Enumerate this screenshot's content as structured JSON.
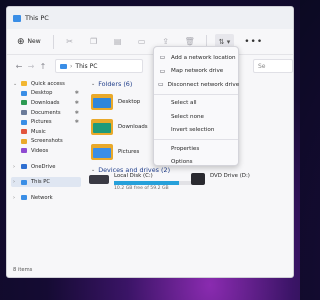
{
  "window": {
    "title": "This PC"
  },
  "toolbar": {
    "new_label": "New",
    "icons": [
      "scissors-icon",
      "copy-icon",
      "paste-icon",
      "rename-icon",
      "share-icon",
      "delete-icon"
    ],
    "sort_icon": "sort-icon",
    "more_label": "•••"
  },
  "address": {
    "back": "←",
    "forward": "→",
    "up": "↑",
    "path_label": "This PC",
    "search_placeholder": "Se"
  },
  "sidebar": {
    "items": [
      {
        "label": "Quick access",
        "color": "#f2b632",
        "pinned": false,
        "expand": true
      },
      {
        "label": "Desktop",
        "color": "#3a8ee6",
        "pinned": true
      },
      {
        "label": "Downloads",
        "color": "#2d9a52",
        "pinned": true
      },
      {
        "label": "Documents",
        "color": "#6b7b99",
        "pinned": true
      },
      {
        "label": "Pictures",
        "color": "#3a8ee6",
        "pinned": true
      },
      {
        "label": "Music",
        "color": "#e2553d",
        "pinned": false
      },
      {
        "label": "Screenshots",
        "color": "#e9a92a",
        "pinned": false
      },
      {
        "label": "Videos",
        "color": "#8f4bd1",
        "pinned": false
      },
      {
        "label": "OneDrive",
        "color": "#2f6fd1",
        "pinned": false,
        "expand": true
      },
      {
        "label": "This PC",
        "color": "#3a8ee6",
        "pinned": false,
        "expand": true,
        "selected": true
      },
      {
        "label": "Network",
        "color": "#3a8ee6",
        "pinned": false,
        "expand": true
      }
    ]
  },
  "main": {
    "folders_header": "Folders (6)",
    "folders": [
      {
        "label": "Desktop",
        "color": "#2f86db"
      },
      {
        "label": "Downloads",
        "color": "#1f9a7a"
      },
      {
        "label": "Pictures",
        "color": "#3a8ee6"
      }
    ],
    "devices_header": "Devices and drives (2)",
    "drives": [
      {
        "label": "Local Disk (C:)",
        "detail": "10.2 GB free of 59.2 GB",
        "used_fraction": 0.83
      },
      {
        "label": "DVD Drive (D:)"
      }
    ]
  },
  "status": {
    "items_count": "8 items"
  },
  "context_menu": {
    "items": [
      {
        "icon": "add-network-location-icon",
        "glyph": "▭",
        "label": "Add a network location"
      },
      {
        "icon": "map-network-drive-icon",
        "glyph": "▭",
        "label": "Map network drive"
      },
      {
        "icon": "disconnect-network-drive-icon",
        "glyph": "▭",
        "label": "Disconnect network drive"
      },
      {
        "separator": true
      },
      {
        "icon": "select-all-icon",
        "glyph": "",
        "label": "Select all"
      },
      {
        "icon": "select-none-icon",
        "glyph": "",
        "label": "Select none"
      },
      {
        "icon": "invert-selection-icon",
        "glyph": "",
        "label": "Invert selection"
      },
      {
        "separator": true
      },
      {
        "icon": "properties-icon",
        "glyph": "",
        "label": "Properties"
      },
      {
        "icon": "options-icon",
        "glyph": "",
        "label": "Options"
      }
    ]
  }
}
